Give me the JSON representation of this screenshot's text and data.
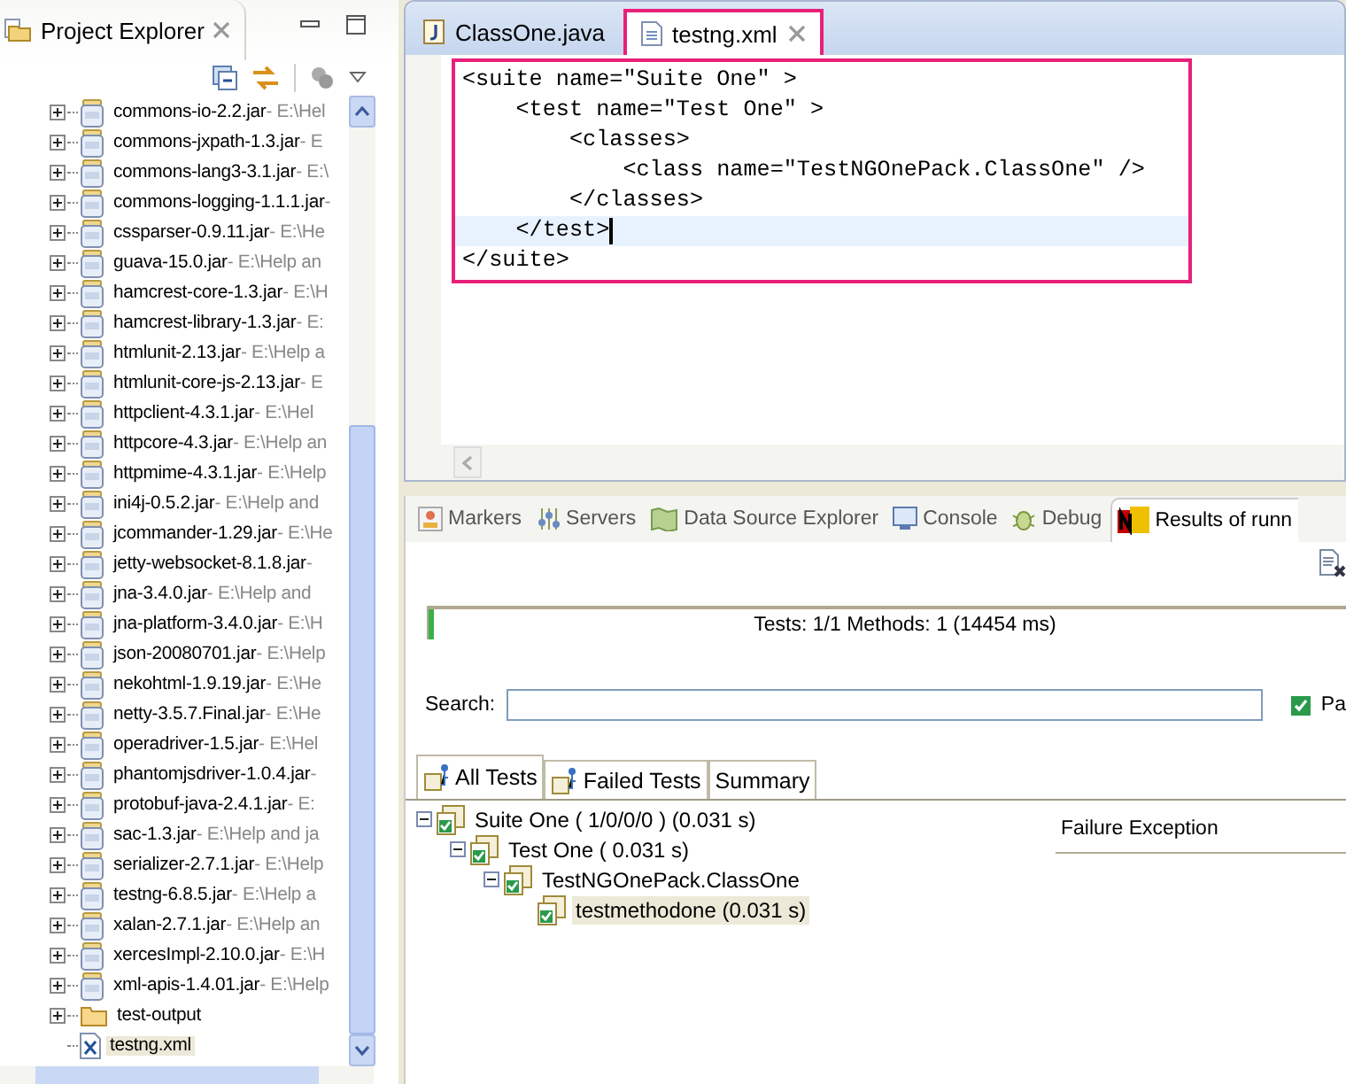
{
  "project_explorer": {
    "title": "Project Explorer",
    "items": [
      {
        "kind": "jar",
        "name": "commons-io-2.2.jar",
        "path": "- E:\\Hel",
        "selected": false
      },
      {
        "kind": "jar",
        "name": "commons-jxpath-1.3.jar",
        "path": "- E",
        "selected": false
      },
      {
        "kind": "jar",
        "name": "commons-lang3-3.1.jar",
        "path": "- E:\\",
        "selected": false
      },
      {
        "kind": "jar",
        "name": "commons-logging-1.1.1.jar",
        "path": "-",
        "selected": false
      },
      {
        "kind": "jar",
        "name": "cssparser-0.9.11.jar",
        "path": "- E:\\He",
        "selected": false
      },
      {
        "kind": "jar",
        "name": "guava-15.0.jar",
        "path": "- E:\\Help an",
        "selected": false
      },
      {
        "kind": "jar",
        "name": "hamcrest-core-1.3.jar",
        "path": "- E:\\H",
        "selected": false
      },
      {
        "kind": "jar",
        "name": "hamcrest-library-1.3.jar",
        "path": "- E:",
        "selected": false
      },
      {
        "kind": "jar",
        "name": "htmlunit-2.13.jar",
        "path": "- E:\\Help a",
        "selected": false
      },
      {
        "kind": "jar",
        "name": "htmlunit-core-js-2.13.jar",
        "path": "- E",
        "selected": false
      },
      {
        "kind": "jar",
        "name": "httpclient-4.3.1.jar",
        "path": "- E:\\Hel",
        "selected": false
      },
      {
        "kind": "jar",
        "name": "httpcore-4.3.jar",
        "path": "- E:\\Help an",
        "selected": false
      },
      {
        "kind": "jar",
        "name": "httpmime-4.3.1.jar",
        "path": "- E:\\Help",
        "selected": false
      },
      {
        "kind": "jar",
        "name": "ini4j-0.5.2.jar",
        "path": "- E:\\Help and",
        "selected": false
      },
      {
        "kind": "jar",
        "name": "jcommander-1.29.jar",
        "path": "- E:\\He",
        "selected": false
      },
      {
        "kind": "jar",
        "name": "jetty-websocket-8.1.8.jar",
        "path": "-",
        "selected": false
      },
      {
        "kind": "jar",
        "name": "jna-3.4.0.jar",
        "path": "- E:\\Help and",
        "selected": false
      },
      {
        "kind": "jar",
        "name": "jna-platform-3.4.0.jar",
        "path": "- E:\\H",
        "selected": false
      },
      {
        "kind": "jar",
        "name": "json-20080701.jar",
        "path": "- E:\\Help",
        "selected": false
      },
      {
        "kind": "jar",
        "name": "nekohtml-1.9.19.jar",
        "path": "- E:\\He",
        "selected": false
      },
      {
        "kind": "jar",
        "name": "netty-3.5.7.Final.jar",
        "path": "- E:\\He",
        "selected": false
      },
      {
        "kind": "jar",
        "name": "operadriver-1.5.jar",
        "path": "- E:\\Hel",
        "selected": false
      },
      {
        "kind": "jar",
        "name": "phantomjsdriver-1.0.4.jar",
        "path": "-",
        "selected": false
      },
      {
        "kind": "jar",
        "name": "protobuf-java-2.4.1.jar",
        "path": "- E:",
        "selected": false
      },
      {
        "kind": "jar",
        "name": "sac-1.3.jar",
        "path": "- E:\\Help and ja",
        "selected": false
      },
      {
        "kind": "jar",
        "name": "serializer-2.7.1.jar",
        "path": "- E:\\Help",
        "selected": false
      },
      {
        "kind": "jar",
        "name": "testng-6.8.5.jar",
        "path": "- E:\\Help a",
        "selected": false
      },
      {
        "kind": "jar",
        "name": "xalan-2.7.1.jar",
        "path": "- E:\\Help an",
        "selected": false
      },
      {
        "kind": "jar",
        "name": "xercesImpl-2.10.0.jar",
        "path": "- E:\\H",
        "selected": false
      },
      {
        "kind": "jar",
        "name": "xml-apis-1.4.01.jar",
        "path": "- E:\\Help",
        "selected": false
      },
      {
        "kind": "folder",
        "name": "test-output",
        "selected": false
      },
      {
        "kind": "xml",
        "name": "testng.xml",
        "selected": true
      }
    ]
  },
  "editor": {
    "tabs": [
      {
        "label": "ClassOne.java",
        "kind": "java",
        "selected": false,
        "highlighted": false
      },
      {
        "label": "testng.xml",
        "kind": "xml",
        "selected": true,
        "highlighted": true
      }
    ],
    "code_highlighted": true,
    "lines": [
      {
        "text": "<suite name=\"Suite One\" >",
        "current": false
      },
      {
        "text": "    <test name=\"Test One\" >",
        "current": false
      },
      {
        "text": "        <classes>",
        "current": false
      },
      {
        "text": "            <class name=\"TestNGOnePack.ClassOne\" />",
        "current": false
      },
      {
        "text": "        </classes>",
        "current": false
      },
      {
        "text": "    </test>",
        "current": true
      },
      {
        "text": "</suite>",
        "current": false
      }
    ]
  },
  "bottom_panel": {
    "tabs": [
      {
        "label": "Markers",
        "kind": "markers",
        "selected": false
      },
      {
        "label": "Servers",
        "kind": "servers",
        "selected": false
      },
      {
        "label": "Data Source Explorer",
        "kind": "datasource",
        "selected": false
      },
      {
        "label": "Console",
        "kind": "console",
        "selected": false
      },
      {
        "label": "Debug",
        "kind": "debug",
        "selected": false
      },
      {
        "label": "Results of runn",
        "kind": "testng",
        "selected": true
      }
    ],
    "progress": {
      "level": 0.005,
      "summary": "Tests: 1/1  Methods: 1 (14454 ms)"
    },
    "search": {
      "label": "Search:"
    },
    "passed_filter": {
      "label": "Pa",
      "checked": true
    },
    "result_tabs": [
      {
        "label": "All Tests",
        "icon": true,
        "selected": true
      },
      {
        "label": "Failed Tests",
        "icon": true,
        "selected": false
      },
      {
        "label": "Summary",
        "icon": false,
        "selected": false
      }
    ],
    "results_tree": [
      {
        "label": "Suite One ( 1/0/0/0 ) (0.031 s)",
        "expanded": true,
        "selected": false,
        "children": [
          {
            "label": "Test One ( 0.031 s)",
            "expanded": true,
            "selected": false,
            "children": [
              {
                "label": "TestNGOnePack.ClassOne",
                "expanded": true,
                "selected": false,
                "children": [
                  {
                    "label": "testmethodone  (0.031 s)",
                    "selected": true
                  }
                ]
              }
            ]
          }
        ]
      }
    ],
    "failure_header": "Failure Exception"
  }
}
